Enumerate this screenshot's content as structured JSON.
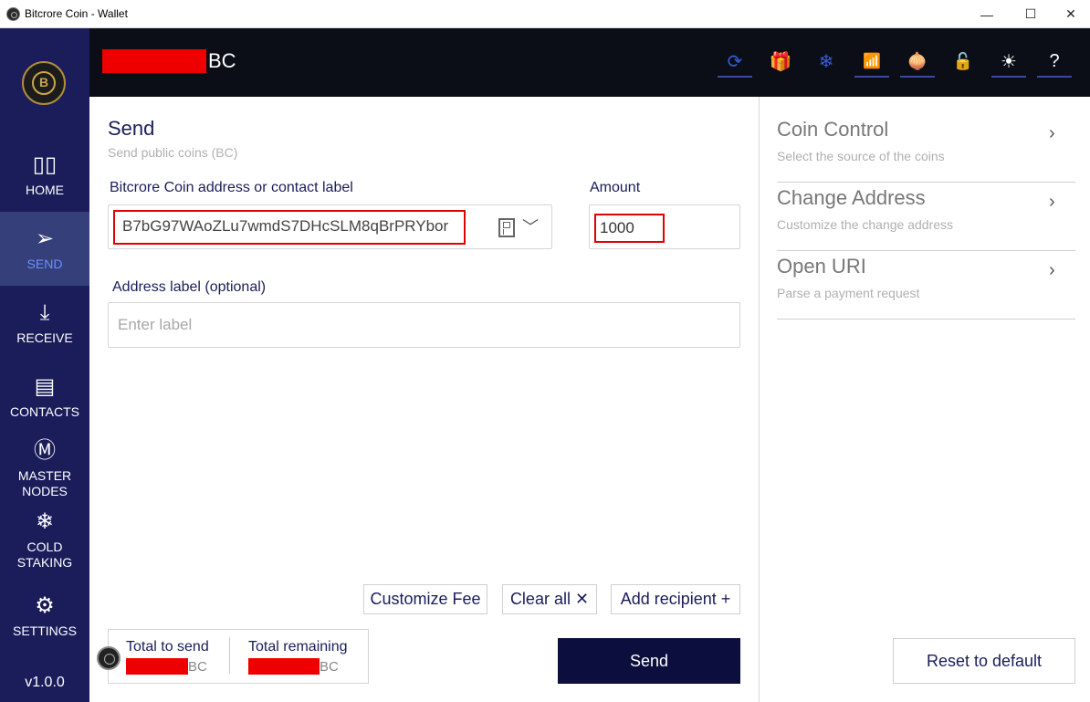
{
  "window": {
    "title": "Bitcrore Coin - Wallet",
    "min_glyph": "—",
    "max_glyph": "☐",
    "close_glyph": "✕"
  },
  "sidebar": {
    "items": [
      {
        "label": "HOME",
        "icon": "home-grid-icon",
        "glyph": "▯▯"
      },
      {
        "label": "SEND",
        "icon": "send-plane-icon",
        "glyph": "➢"
      },
      {
        "label": "RECEIVE",
        "icon": "download-icon",
        "glyph": "⤓"
      },
      {
        "label": "CONTACTS",
        "icon": "contacts-book-icon",
        "glyph": "▤"
      },
      {
        "label": "MASTER\nNODES",
        "icon": "masternodes-icon",
        "glyph": "Ⓜ"
      },
      {
        "label": "COLD\nSTAKING",
        "icon": "snowflake-icon",
        "glyph": "❄"
      },
      {
        "label": "SETTINGS",
        "icon": "gear-icon",
        "glyph": "⚙"
      }
    ],
    "active": "SEND",
    "version": "v1.0.0"
  },
  "header": {
    "balance_unit": "BC",
    "buttons": [
      {
        "name": "sync-icon",
        "glyph": "⟳",
        "color": "#3a5bd9"
      },
      {
        "name": "gift-icon",
        "glyph": "🎁",
        "color": "#ffffff"
      },
      {
        "name": "cold-staking-snowflake-icon",
        "glyph": "❄",
        "color": "#3a5bd9"
      },
      {
        "name": "network-wifi-icon",
        "glyph": "📶",
        "color": "#3a5bd9"
      },
      {
        "name": "tor-onion-icon",
        "glyph": "🧅",
        "color": "#ffffff"
      },
      {
        "name": "lock-open-icon",
        "glyph": "🔓",
        "color": "#ffffff"
      },
      {
        "name": "theme-sun-icon",
        "glyph": "☀",
        "color": "#ffffff"
      },
      {
        "name": "help-icon",
        "glyph": "?",
        "color": "#ffffff"
      }
    ]
  },
  "send": {
    "title": "Send",
    "subtitle": "Send public coins (BC)",
    "address_label": "Bitcrore Coin address or contact label",
    "address_value": "B7bG97WAoZLu7wmdS7DHcSLM8qBrPRYbor",
    "amount_label": "Amount",
    "amount_value": "1000",
    "addr_label_label": "Address label (optional)",
    "addr_label_placeholder": "Enter label",
    "customize_fee": "Customize Fee",
    "clear_all": "Clear all ✕",
    "add_recipient": "Add recipient +",
    "total_to_send": "Total to send",
    "total_remaining": "Total remaining",
    "unit": "BC",
    "send_button": "Send"
  },
  "options": [
    {
      "title": "Coin Control",
      "subtitle": "Select the source of the coins"
    },
    {
      "title": "Change Address",
      "subtitle": "Customize the change address"
    },
    {
      "title": "Open URI",
      "subtitle": "Parse a payment request"
    }
  ],
  "chevron": "›",
  "reset_button": "Reset to default",
  "colors": {
    "sidebar": "#1a1d5a",
    "active_nav": "#35407a",
    "header": "#0b0e17",
    "send_button": "#0c0f3d",
    "redaction": "#ee0000"
  }
}
